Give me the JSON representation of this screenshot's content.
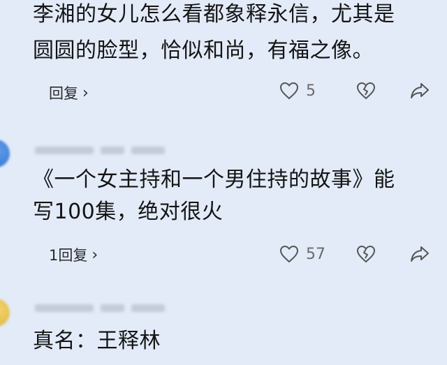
{
  "comments": [
    {
      "text_lines": [
        "李湘的女儿怎么看都象释永信，尤其是",
        "圆圆的脸型，恰似和尚，有福之像。"
      ],
      "reply_label": "回复",
      "like_count": "5"
    },
    {
      "text_lines": [
        "《一个女主持和一个男住持的故事》能",
        "写100集，绝对很火"
      ],
      "reply_label": "1回复",
      "like_count": "57"
    },
    {
      "text_lines": [
        "真名：王释林"
      ]
    }
  ],
  "icons": {
    "chevron": "chevron-right-icon",
    "like": "heart-outline-icon",
    "dislike": "broken-heart-icon",
    "share": "share-arrow-icon"
  }
}
